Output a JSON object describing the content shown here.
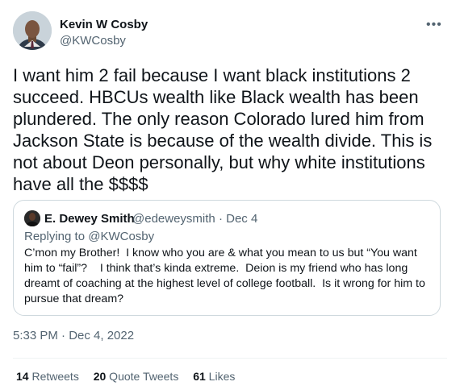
{
  "tweet": {
    "author": {
      "name": "Kevin W Cosby",
      "handle": "@KWCosby"
    },
    "more_icon": "more-dots-icon",
    "text": "I want him 2 fail because I want black institutions 2\nsucceed. HBCUs wealth like Black wealth has been\nplundered. The only reason Colorado lured him from\nJackson State is because of the wealth divide. This is\nnot about Deon personally, but why white institutions\nhave all the $$$$",
    "timestamp": "5:33 PM · Dec 4, 2022"
  },
  "quoted": {
    "name": "E. Dewey Smith",
    "handle": "@edeweysmith",
    "separator": " · ",
    "date": "Dec 4",
    "replying_label": "Replying to ",
    "replying_to": "@KWCosby",
    "text": "C’mon my Brother!  I know who you are & what you mean to us but “You want\nhim to “fail”?    I think that’s kinda extreme.  Deion is my friend who has long\ndreamt of coaching at the highest level of college football.  Is it wrong for him to\npursue that dream?"
  },
  "stats": {
    "retweets_count": "14",
    "retweets_label": " Retweets",
    "quotes_count": "20",
    "quotes_label": " Quote Tweets",
    "likes_count": "61",
    "likes_label": " Likes"
  },
  "colors": {
    "text": "#0f1419",
    "secondary": "#536471",
    "border": "#cfd9de"
  }
}
